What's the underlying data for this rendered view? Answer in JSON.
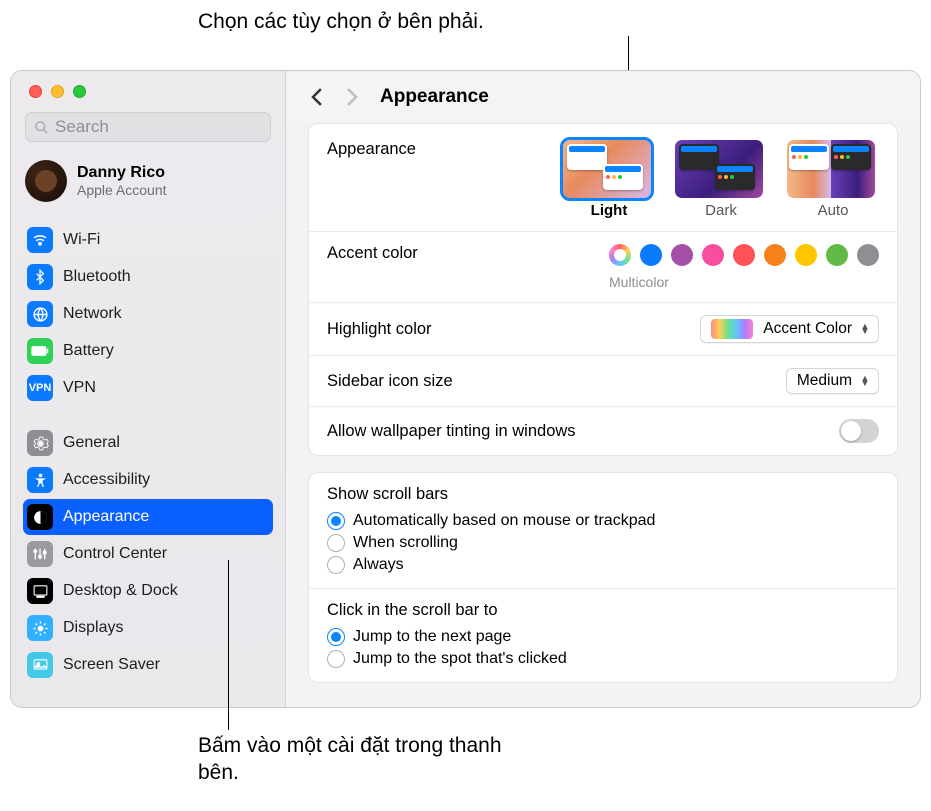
{
  "annotations": {
    "top": "Chọn các tùy chọn ở bên phải.",
    "bottom": "Bấm vào một cài đặt trong thanh bên."
  },
  "search": {
    "placeholder": "Search"
  },
  "account": {
    "name": "Danny Rico",
    "sub": "Apple Account"
  },
  "sidebar": {
    "group1": [
      {
        "label": "Wi-Fi",
        "icon": "wifi",
        "bg": "#0a7aff",
        "fg": "#fff"
      },
      {
        "label": "Bluetooth",
        "icon": "bluetooth",
        "bg": "#0a7aff",
        "fg": "#fff"
      },
      {
        "label": "Network",
        "icon": "network",
        "bg": "#0a7aff",
        "fg": "#fff"
      },
      {
        "label": "Battery",
        "icon": "battery",
        "bg": "#30d158",
        "fg": "#fff"
      },
      {
        "label": "VPN",
        "icon": "vpn",
        "bg": "#0a7aff",
        "fg": "#fff"
      }
    ],
    "group2": [
      {
        "label": "General",
        "icon": "gear",
        "bg": "#8e8e93",
        "fg": "#fff"
      },
      {
        "label": "Accessibility",
        "icon": "access",
        "bg": "#0a7aff",
        "fg": "#fff"
      },
      {
        "label": "Appearance",
        "icon": "appear",
        "bg": "#000000",
        "fg": "#fff",
        "selected": true
      },
      {
        "label": "Control Center",
        "icon": "controls",
        "bg": "#9a9aa0",
        "fg": "#fff"
      },
      {
        "label": "Desktop & Dock",
        "icon": "dock",
        "bg": "#000000",
        "fg": "#fff"
      },
      {
        "label": "Displays",
        "icon": "displays",
        "bg": "#30b0ff",
        "fg": "#fff"
      },
      {
        "label": "Screen Saver",
        "icon": "screensv",
        "bg": "#44c8e8",
        "fg": "#fff"
      }
    ]
  },
  "header": {
    "title": "Appearance"
  },
  "appearance": {
    "label": "Appearance",
    "options": [
      {
        "label": "Light",
        "selected": true
      },
      {
        "label": "Dark"
      },
      {
        "label": "Auto"
      }
    ]
  },
  "accent": {
    "label": "Accent color",
    "sub": "Multicolor",
    "colors": [
      {
        "name": "multicolor",
        "value": "conic",
        "selected": true
      },
      {
        "name": "blue",
        "value": "#0a7aff"
      },
      {
        "name": "purple",
        "value": "#a550a7"
      },
      {
        "name": "pink",
        "value": "#f74f9e"
      },
      {
        "name": "red",
        "value": "#ff5257"
      },
      {
        "name": "orange",
        "value": "#f7821b"
      },
      {
        "name": "yellow",
        "value": "#ffc600"
      },
      {
        "name": "green",
        "value": "#62ba46"
      },
      {
        "name": "graphite",
        "value": "#8e8e93"
      }
    ]
  },
  "highlight": {
    "label": "Highlight color",
    "value": "Accent Color"
  },
  "sidebar_size": {
    "label": "Sidebar icon size",
    "value": "Medium"
  },
  "tinting": {
    "label": "Allow wallpaper tinting in windows",
    "on": false
  },
  "scrollbars": {
    "label": "Show scroll bars",
    "options": [
      {
        "label": "Automatically based on mouse or trackpad",
        "checked": true
      },
      {
        "label": "When scrolling"
      },
      {
        "label": "Always"
      }
    ]
  },
  "click_scroll": {
    "label": "Click in the scroll bar to",
    "options": [
      {
        "label": "Jump to the next page",
        "checked": true
      },
      {
        "label": "Jump to the spot that's clicked"
      }
    ]
  }
}
